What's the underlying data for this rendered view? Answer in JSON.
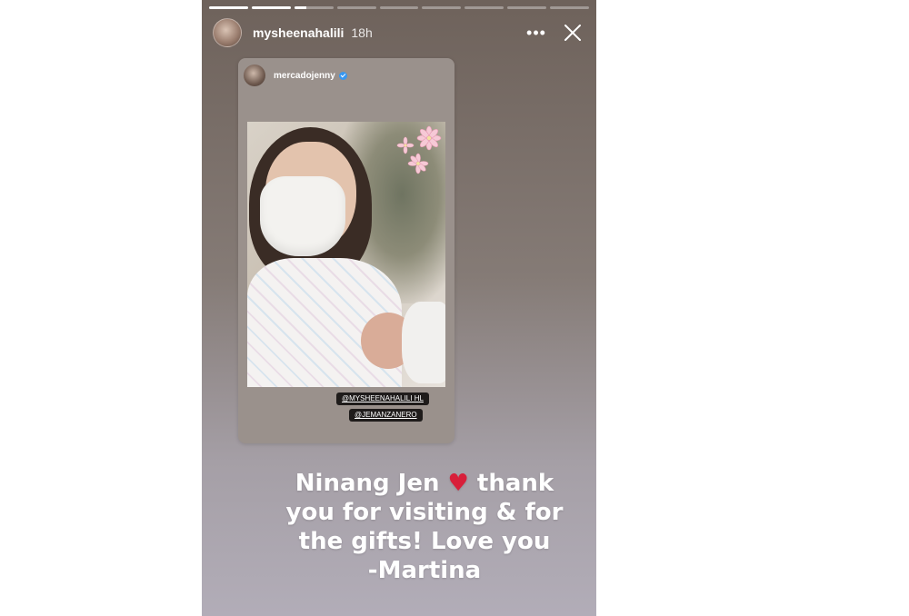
{
  "story": {
    "progress": [
      1,
      1,
      0.3,
      0,
      0,
      0,
      0,
      0,
      0
    ],
    "header": {
      "username": "mysheenahalili",
      "time": "18h",
      "more_label": "•••",
      "close_label": "Close"
    },
    "shared_post": {
      "username": "mercadojenny",
      "verified": true,
      "mentions": [
        "@MYSHEENAHALILI HL",
        "@JEMANZANERO"
      ]
    },
    "caption": {
      "line1_a": "Ninang Jen",
      "heart": "♥",
      "line1_b": "thank",
      "line2": "you for visiting & for",
      "line3": "the gifts! Love you",
      "line4": "-Martina"
    },
    "colors": {
      "heart": "#d81f3a",
      "verified": "#3897f0"
    }
  }
}
